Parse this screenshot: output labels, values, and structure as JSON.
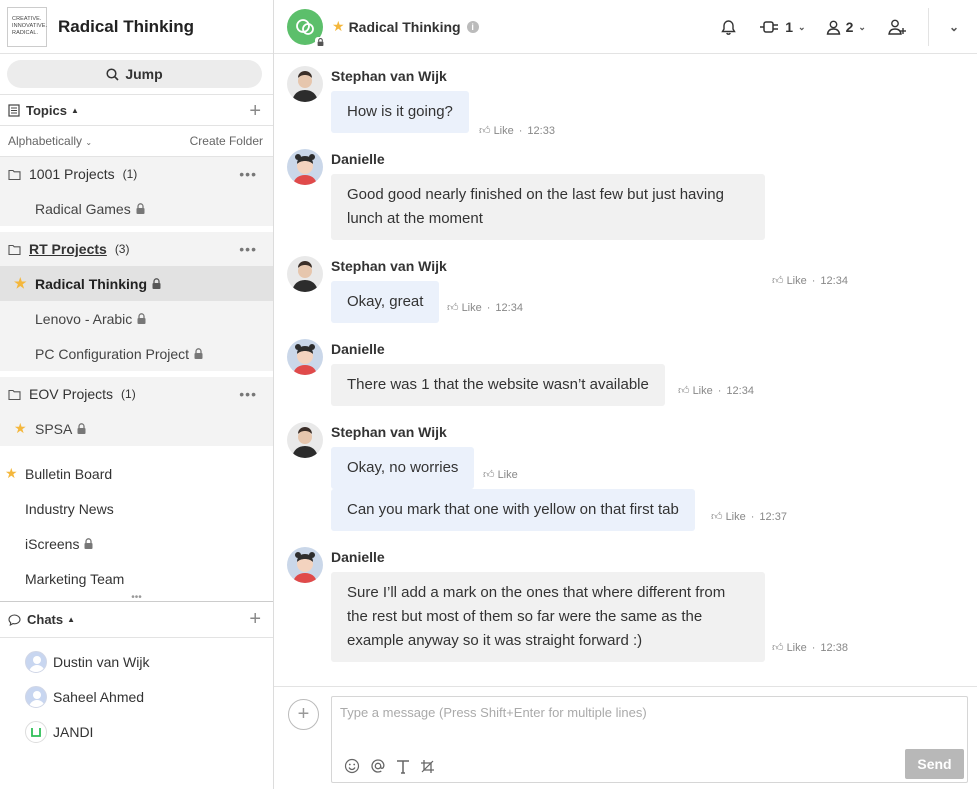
{
  "team": {
    "logo_lines": [
      "CREATIVE.",
      "INNOVATIVE.",
      "RADICAL."
    ],
    "name": "Radical Thinking"
  },
  "jump": {
    "label": "Jump"
  },
  "topics": {
    "header": "Topics",
    "sort_label": "Alphabetically",
    "create_folder": "Create Folder",
    "folders": [
      {
        "name": "1001 Projects",
        "count": "(1)",
        "items": [
          {
            "name": "Radical Games",
            "locked": true,
            "starred": false
          }
        ]
      },
      {
        "name": "RT Projects",
        "count": "(3)",
        "items": [
          {
            "name": "Radical Thinking",
            "locked": true,
            "starred": true,
            "active": true
          },
          {
            "name": "Lenovo - Arabic",
            "locked": true,
            "starred": false
          },
          {
            "name": "PC Configuration Project",
            "locked": true,
            "starred": false
          }
        ]
      },
      {
        "name": "EOV Projects",
        "count": "(1)",
        "items": [
          {
            "name": "SPSA",
            "locked": true,
            "starred": true
          }
        ]
      }
    ],
    "loose": [
      {
        "name": "Bulletin Board",
        "starred": true,
        "locked": false
      },
      {
        "name": "Industry News",
        "starred": false,
        "locked": false
      },
      {
        "name": "iScreens",
        "starred": false,
        "locked": true
      },
      {
        "name": "Marketing Team",
        "starred": false,
        "locked": false
      }
    ]
  },
  "chats": {
    "header": "Chats",
    "items": [
      {
        "name": "Dustin van Wijk"
      },
      {
        "name": "Saheel Ahmed"
      },
      {
        "name": "JANDI"
      }
    ]
  },
  "topbar": {
    "title": "Radical Thinking",
    "info": "i",
    "connect_count": "1",
    "members_count": "2"
  },
  "messages": [
    {
      "sender": "Stephan van Wijk",
      "text": "How is it going?",
      "like": "Like",
      "time": "12:33"
    },
    {
      "sender": "Danielle",
      "text": "Good good nearly finished on the last few but just having lunch at the moment",
      "like": "Like",
      "time": "12:34"
    },
    {
      "sender": "Stephan van Wijk",
      "text": "Okay, great",
      "like": "Like",
      "time": "12:34"
    },
    {
      "sender": "Danielle",
      "text": "There was 1 that the website wasn’t available",
      "like": "Like",
      "time": "12:34"
    },
    {
      "sender": "Stephan van Wijk",
      "text": "Okay, no worries",
      "like": "Like",
      "time": ""
    },
    {
      "sender": "",
      "text": "Can you mark that one with yellow on that first tab",
      "like": "Like",
      "time": "12:37"
    },
    {
      "sender": "Danielle",
      "text": "Sure I’ll add a mark on the ones that where different from the rest  but most of them so far were the same as the example anyway so it was straight forward :)",
      "like": "Like",
      "time": "12:38"
    }
  ],
  "composer": {
    "placeholder": "Type a message (Press Shift+Enter for multiple lines)",
    "send": "Send"
  },
  "colors": {
    "accent_green": "#5cbf6b",
    "star": "#f4b73c",
    "mine_bubble": "#ebf1fb",
    "other_bubble": "#f1f1f1"
  }
}
